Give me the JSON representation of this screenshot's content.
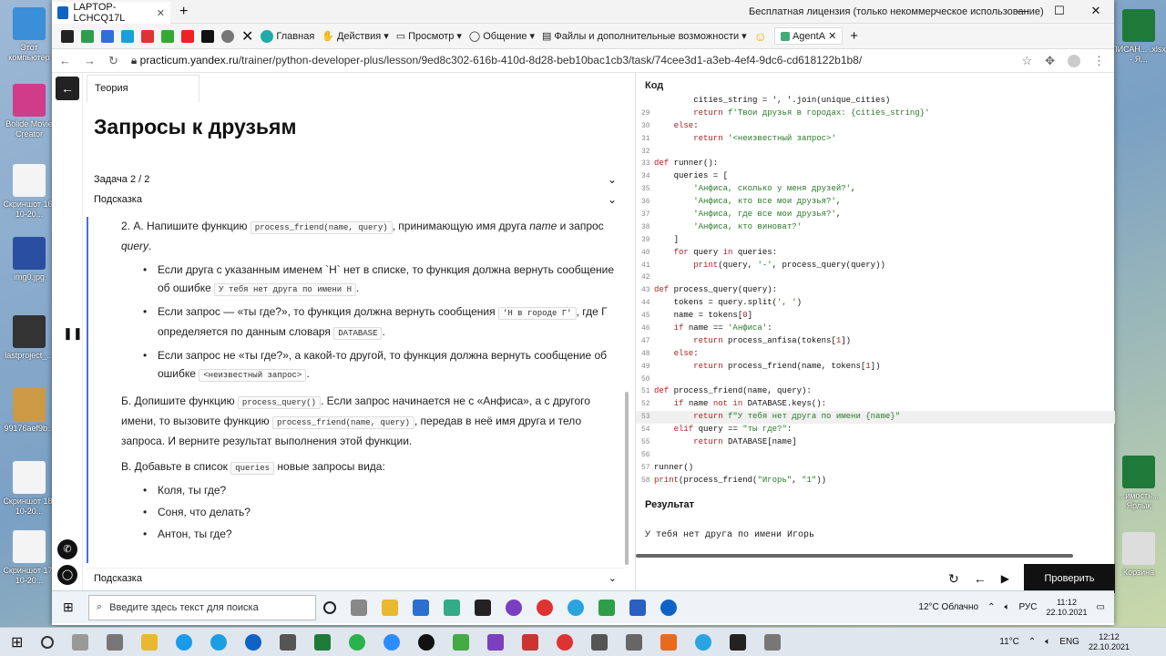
{
  "desktop": {
    "icons": [
      "Этот компьютер",
      "Bolide Movie Creator",
      "Скриншот 16-10-20...",
      "img0.jpg",
      "lastproject_...",
      "99176aef9b...",
      "Скриншот 18-10-20...",
      "Скриншот 17-10-20..."
    ],
    "right_icons": [
      "ПИСАН... .xlsx - Я...",
      "...имость... Ярлык",
      "Корзина"
    ]
  },
  "teamviewer": {
    "tab_label": "LAPTOP-LCHCQ17L",
    "license_text": "Бесплатная лицензия (только некоммерческое использование)"
  },
  "toolbar": {
    "home": "Главная",
    "actions": "Действия",
    "view": "Просмотр",
    "communicate": "Общение",
    "files": "Файлы и дополнительные возможности",
    "agent": "AgentA"
  },
  "address": {
    "url_host": "practicum.yandex.ru",
    "url_path": "/trainer/python-developer-plus/lesson/9ed8c302-616b-410d-8d28-beb10bac1cb3/task/74cee3d1-a3eb-4ef4-9dc6-cd618122b1b8/"
  },
  "lesson": {
    "theory_tab": "Теория",
    "title": "Запросы к друзьям",
    "task_label": "Задача   2 / 2",
    "hint_label": "Подсказка",
    "p1_num": "2. А. Напишите функцию",
    "p1_code": "process_friend(name, query)",
    "p1_rest": ", принимающую имя друга",
    "p1_name": "name",
    "p1_and": "и запрос",
    "p1_query": "query",
    "b1_text": "Если друга с указанным именем `Н` нет в списке, то функция должна вернуть сообщение об ошибке",
    "b1_code": "У тебя нет друга по имени Н",
    "b2_text": "Если запрос — «ты где?», то функция должна вернуть сообщения",
    "b2_code": "'Н в городе Г'",
    "b2_rest": ", где Г определяется по данным словаря",
    "b2_code2": "DATABASE",
    "b3_text": "Если запрос не «ты где?», а какой-то другой, то функция должна вернуть сообщение об ошибке",
    "b3_code": "<неизвестный запрос>",
    "pB_text": "Б. Допишите функцию",
    "pB_code": "process_query()",
    "pB_rest": ". Если запрос начинается не с «Анфиса», а с другого имени, то вызовите функцию",
    "pB_code2": "process_friend(name, query)",
    "pB_rest2": ", передав в неё имя друга и тело запроса. И верните результат выполнения этой функции.",
    "pC_text": "В. Добавьте в список",
    "pC_code": "queries",
    "pC_rest": "новые запросы вида:",
    "q1": "Коля, ты где?",
    "q2": "Соня, что делать?",
    "q3": "Антон, ты где?",
    "hint_bottom": "Подсказка"
  },
  "editor": {
    "header": "Код",
    "result_header": "Результат",
    "result_value": "У тебя нет друга по имени  Игорь",
    "check_button": "Проверить"
  },
  "remote_taskbar": {
    "search_placeholder": "Введите здесь текст для поиска",
    "weather": "12°C  Облачно",
    "lang": "РУС",
    "time": "11:12",
    "date": "22.10.2021"
  },
  "local_taskbar": {
    "weather": "11°C",
    "lang": "ENG",
    "time": "12:12",
    "date": "22.10.2021"
  }
}
